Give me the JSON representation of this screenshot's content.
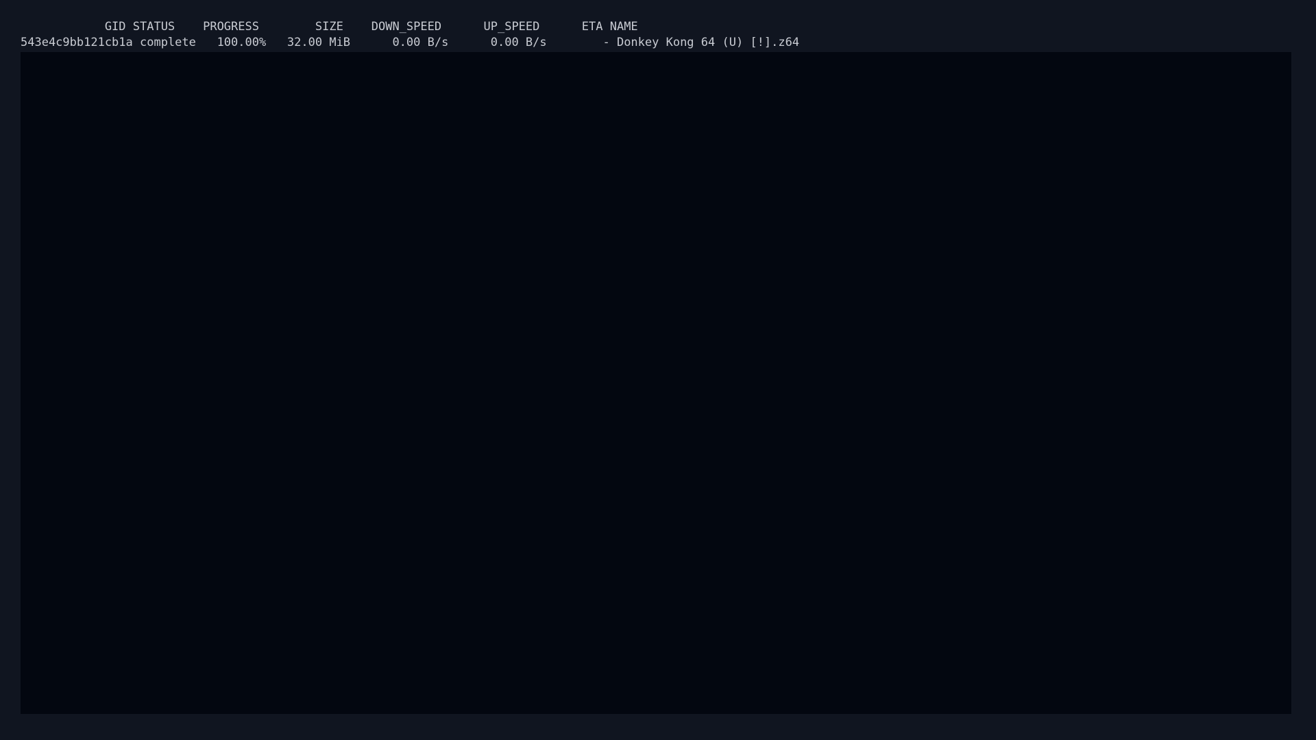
{
  "terminal": {
    "header_line": "            GID STATUS    PROGRESS        SIZE    DOWN_SPEED      UP_SPEED      ETA NAME",
    "rows": [
      "543e4c9bb121cb1a complete   100.00%   32.00 MiB      0.00 B/s      0.00 B/s        - Donkey Kong 64 (U) [!].z64"
    ]
  },
  "colors": {
    "window_background": "#101520",
    "terminal_background": "#030710",
    "text": "#c9ccd3"
  }
}
